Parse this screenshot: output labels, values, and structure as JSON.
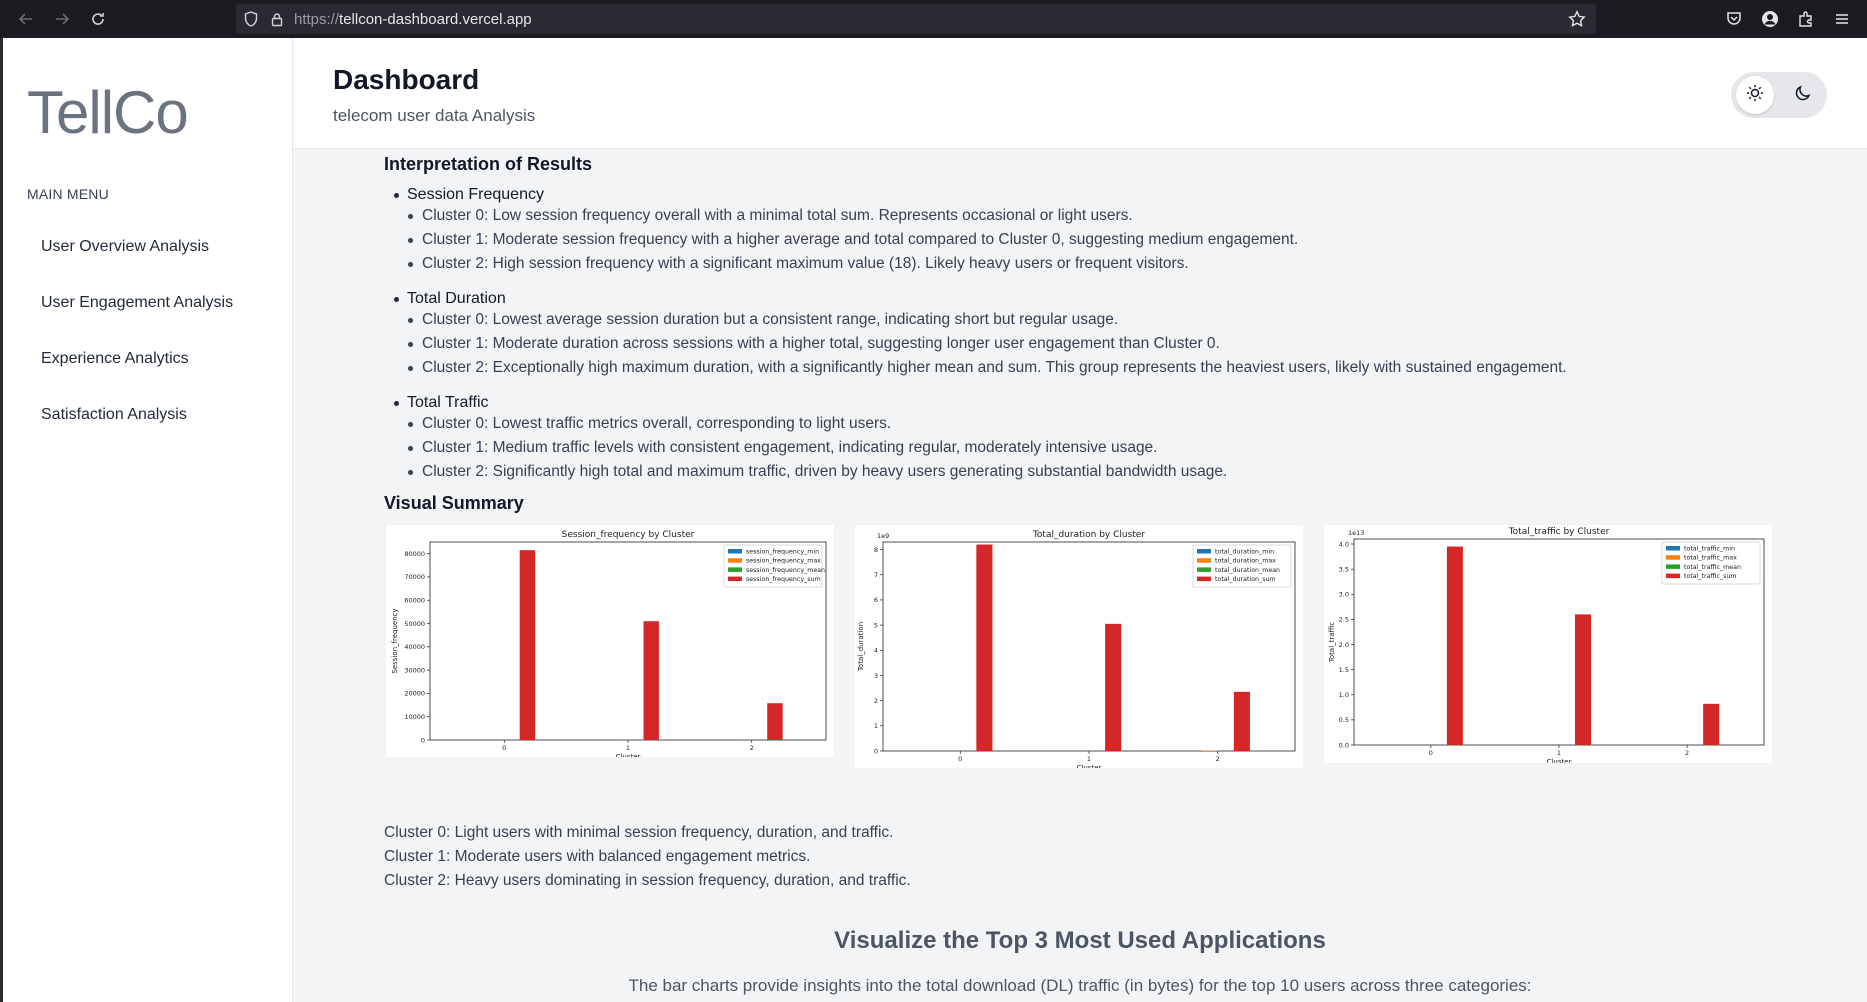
{
  "browser": {
    "url_proto": "https://",
    "url_host": "tellcon-dashboard.vercel.app"
  },
  "sidebar": {
    "logo": "TellCo",
    "menu_title": "MAIN MENU",
    "items": [
      {
        "label": "User Overview Analysis"
      },
      {
        "label": "User Engagement Analysis"
      },
      {
        "label": "Experience Analytics"
      },
      {
        "label": "Satisfaction Analysis"
      }
    ]
  },
  "header": {
    "title": "Dashboard",
    "subtitle": "telecom user data Analysis"
  },
  "content": {
    "interpretation_heading": "Interpretation of Results",
    "sections": [
      {
        "heading": "Session Frequency",
        "bullets": [
          "Cluster 0: Low session frequency overall with a minimal total sum. Represents occasional or light users.",
          "Cluster 1: Moderate session frequency with a higher average and total compared to Cluster 0, suggesting medium engagement.",
          "Cluster 2: High session frequency with a significant maximum value (18). Likely heavy users or frequent visitors."
        ]
      },
      {
        "heading": "Total Duration",
        "bullets": [
          "Cluster 0: Lowest average session duration but a consistent range, indicating short but regular usage.",
          "Cluster 1: Moderate duration across sessions with a higher total, suggesting longer user engagement than Cluster 0.",
          "Cluster 2: Exceptionally high maximum duration, with a significantly higher mean and sum. This group represents the heaviest users, likely with sustained engagement."
        ]
      },
      {
        "heading": "Total Traffic",
        "bullets": [
          "Cluster 0: Lowest traffic metrics overall, corresponding to light users.",
          "Cluster 1: Medium traffic levels with consistent engagement, indicating regular, moderately intensive usage.",
          "Cluster 2: Significantly high total and maximum traffic, driven by heavy users generating substantial bandwidth usage."
        ]
      }
    ],
    "visual_heading": "Visual Summary",
    "summary_lines": [
      "Cluster 0: Light users with minimal session frequency, duration, and traffic.",
      "Cluster 1: Moderate users with balanced engagement metrics.",
      "Cluster 2: Heavy users dominating in session frequency, duration, and traffic."
    ],
    "top3_heading": "Visualize the Top 3 Most Used Applications",
    "top3_desc": "The bar charts provide insights into the total download (DL) traffic (in bytes) for the top 10 users across three categories:"
  },
  "colors": {
    "min": "#1f77b4",
    "max": "#ff7f0e",
    "mean": "#2ca02c",
    "sum": "#d62728"
  },
  "chart_data": [
    {
      "type": "bar",
      "title": "Session_frequency by Cluster",
      "xlabel": "Cluster",
      "ylabel": "Session_frequency",
      "categories": [
        "0",
        "1",
        "2"
      ],
      "ylim": [
        0,
        85000
      ],
      "yticks": [
        0,
        10000,
        20000,
        30000,
        40000,
        50000,
        60000,
        70000,
        80000
      ],
      "ytick_labels": [
        "0",
        "10000",
        "20000",
        "30000",
        "40000",
        "50000",
        "60000",
        "70000",
        "80000"
      ],
      "offset_label": "",
      "legend_position": "top-right",
      "series": [
        {
          "name": "session_frequency_min",
          "values": [
            0,
            1,
            1
          ]
        },
        {
          "name": "session_frequency_max",
          "values": [
            0,
            4,
            18
          ]
        },
        {
          "name": "session_frequency_mean",
          "values": [
            0,
            2,
            5
          ]
        },
        {
          "name": "session_frequency_sum",
          "values": [
            81500,
            51000,
            15800
          ]
        }
      ]
    },
    {
      "type": "bar",
      "title": "Total_duration by Cluster",
      "xlabel": "Cluster",
      "ylabel": "Total_duration",
      "categories": [
        "0",
        "1",
        "2"
      ],
      "ylim": [
        0,
        8.3
      ],
      "yticks": [
        0,
        1,
        2,
        3,
        4,
        5,
        6,
        7,
        8
      ],
      "ytick_labels": [
        "0",
        "1",
        "2",
        "3",
        "4",
        "5",
        "6",
        "7",
        "8"
      ],
      "offset_label": "1e9",
      "legend_position": "top-right",
      "series": [
        {
          "name": "total_duration_min",
          "values": [
            0,
            0,
            0
          ]
        },
        {
          "name": "total_duration_max",
          "values": [
            0,
            0,
            0.02
          ]
        },
        {
          "name": "total_duration_mean",
          "values": [
            0,
            0,
            0
          ]
        },
        {
          "name": "total_duration_sum",
          "values": [
            8.2,
            5.05,
            2.35
          ]
        }
      ]
    },
    {
      "type": "bar",
      "title": "Total_traffic by Cluster",
      "xlabel": "Cluster",
      "ylabel": "Total_traffic",
      "categories": [
        "0",
        "1",
        "2"
      ],
      "ylim": [
        0,
        4.1
      ],
      "yticks": [
        0,
        0.5,
        1,
        1.5,
        2,
        2.5,
        3,
        3.5,
        4
      ],
      "ytick_labels": [
        "0.0",
        "0.5",
        "1.0",
        "1.5",
        "2.0",
        "2.5",
        "3.0",
        "3.5",
        "4.0"
      ],
      "offset_label": "1e13",
      "legend_position": "top-right",
      "series": [
        {
          "name": "total_traffic_min",
          "values": [
            0,
            0,
            0
          ]
        },
        {
          "name": "total_traffic_max",
          "values": [
            0,
            0,
            0
          ]
        },
        {
          "name": "total_traffic_mean",
          "values": [
            0,
            0,
            0
          ]
        },
        {
          "name": "total_traffic_sum",
          "values": [
            3.95,
            2.6,
            0.82
          ]
        }
      ]
    }
  ]
}
